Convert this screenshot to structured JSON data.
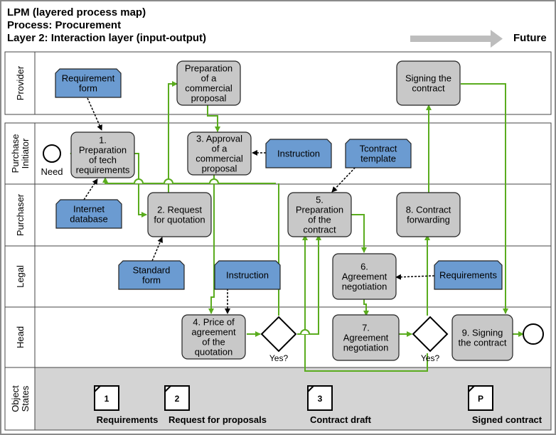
{
  "header": {
    "title": "LPM (layered process map)",
    "process": "Process: Procurement",
    "layer": "Layer 2: Interaction layer (input-output)",
    "future_label": "Future"
  },
  "colors": {
    "flow_green": "#5aac1e",
    "task_fill": "#c8c8c8",
    "doc_fill": "#6b9bd1",
    "states_band": "#d4d4d4",
    "border": "#333333"
  },
  "lanes": [
    {
      "label_lines": [
        "Provider"
      ]
    },
    {
      "label_lines": [
        "Purchase",
        "Initiator"
      ]
    },
    {
      "label_lines": [
        "Purchaser"
      ]
    },
    {
      "label_lines": [
        "Legal"
      ]
    },
    {
      "label_lines": [
        "Head"
      ]
    },
    {
      "label_lines": [
        "Object",
        "States"
      ]
    }
  ],
  "tasks": [
    {
      "id": "t1",
      "lines": [
        "1.",
        "Preparation",
        "of tech",
        "requirements"
      ]
    },
    {
      "id": "tprov1",
      "lines": [
        "Preparation",
        "of a",
        "commercial",
        "proposal"
      ]
    },
    {
      "id": "t3",
      "lines": [
        "3. Approval",
        "of a",
        "commercial",
        "proposal"
      ]
    },
    {
      "id": "t2",
      "lines": [
        "2. Request",
        "for quotation"
      ]
    },
    {
      "id": "t4",
      "lines": [
        "4. Price of",
        "agreement",
        "of the",
        "quotation"
      ]
    },
    {
      "id": "t5",
      "lines": [
        "5.",
        "Preparation",
        "of the",
        "contract"
      ]
    },
    {
      "id": "t6",
      "lines": [
        "6.",
        "Agreement",
        "negotiation"
      ]
    },
    {
      "id": "t7",
      "lines": [
        "7.",
        "Agreement",
        "negotiation"
      ]
    },
    {
      "id": "t8",
      "lines": [
        "8. Contract",
        "forwarding"
      ]
    },
    {
      "id": "tprov2",
      "lines": [
        "Signing the",
        "contract"
      ]
    },
    {
      "id": "t9",
      "lines": [
        "9. Signing",
        "the contract"
      ]
    }
  ],
  "documents": [
    {
      "id": "d1",
      "lines": [
        "Requirement",
        "form"
      ]
    },
    {
      "id": "d2",
      "lines": [
        "Instruction"
      ]
    },
    {
      "id": "d3",
      "lines": [
        "Tcontract",
        "template"
      ]
    },
    {
      "id": "d4",
      "lines": [
        "Internet",
        "database"
      ]
    },
    {
      "id": "d5",
      "lines": [
        "Standard",
        "form"
      ]
    },
    {
      "id": "d6",
      "lines": [
        "Instruction"
      ]
    },
    {
      "id": "d7",
      "lines": [
        "Requirements"
      ]
    }
  ],
  "events": {
    "start_label": "Need"
  },
  "gateways": [
    {
      "id": "g1",
      "label": "Yes?"
    },
    {
      "id": "g2",
      "label": "Yes?"
    }
  ],
  "object_states": [
    {
      "code": "1",
      "label": "Requirements"
    },
    {
      "code": "2",
      "label": "Request for proposals"
    },
    {
      "code": "3",
      "label": "Contract draft"
    },
    {
      "code": "P",
      "label": "Signed contract"
    }
  ]
}
